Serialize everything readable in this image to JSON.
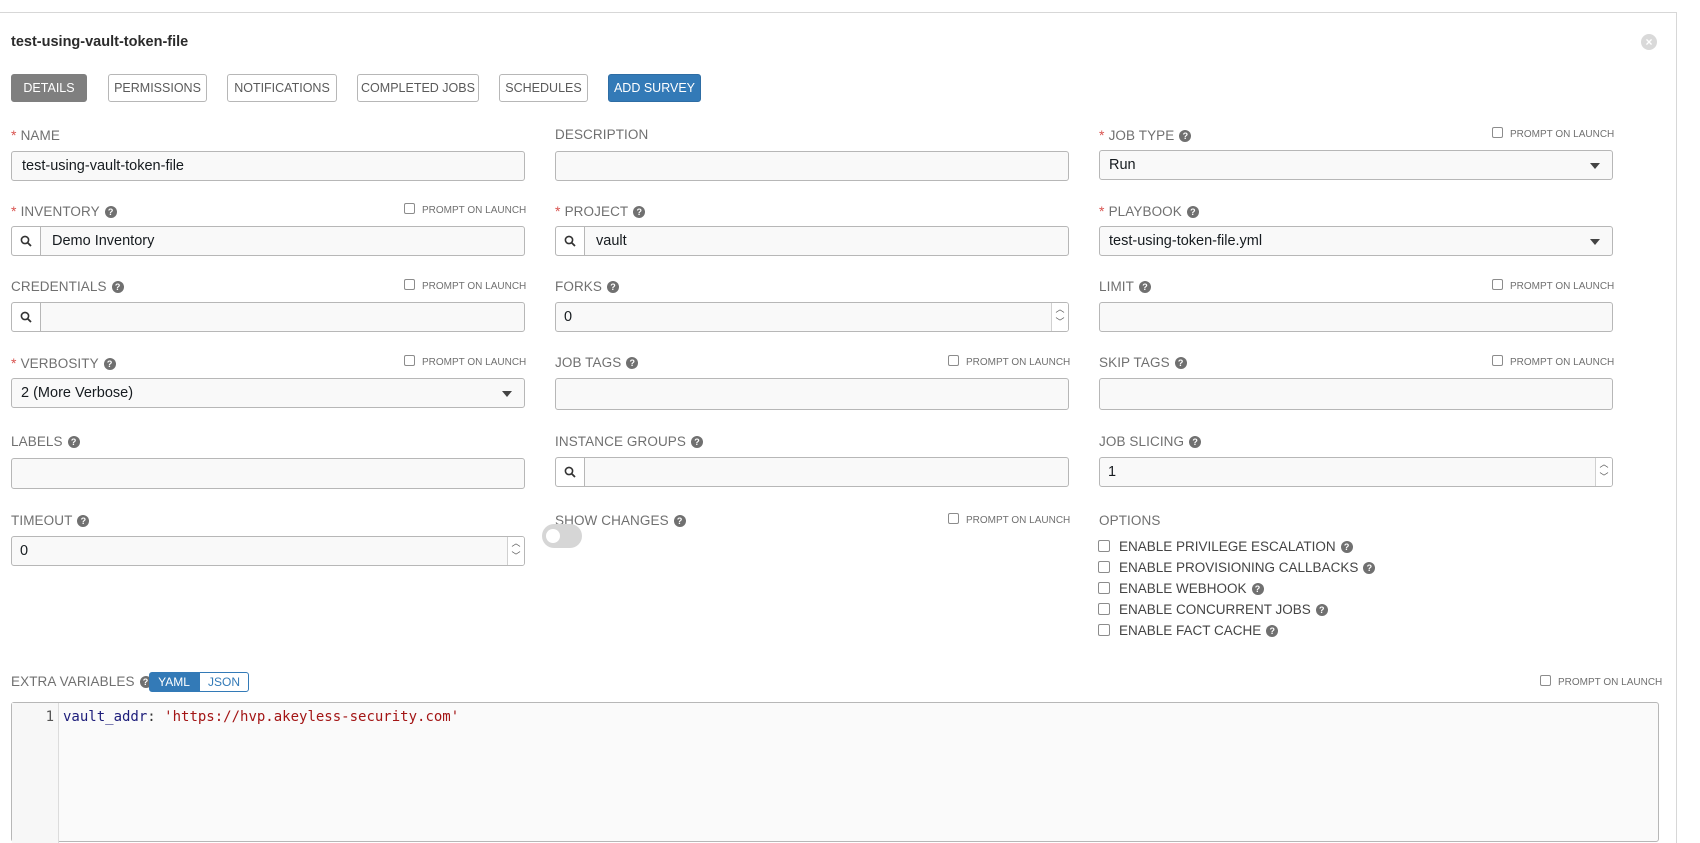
{
  "form": {
    "title": "test-using-vault-token-file",
    "prompt_label": "PROMPT ON LAUNCH"
  },
  "tabs": [
    "DETAILS",
    "PERMISSIONS",
    "NOTIFICATIONS",
    "COMPLETED JOBS",
    "SCHEDULES",
    "ADD SURVEY"
  ],
  "fields": {
    "name": {
      "label": "NAME",
      "value": "test-using-vault-token-file"
    },
    "description": {
      "label": "DESCRIPTION",
      "value": ""
    },
    "job_type": {
      "label": "JOB TYPE",
      "value": "Run"
    },
    "inventory": {
      "label": "INVENTORY",
      "value": "Demo Inventory"
    },
    "project": {
      "label": "PROJECT",
      "value": "vault"
    },
    "playbook": {
      "label": "PLAYBOOK",
      "value": "test-using-token-file.yml"
    },
    "credentials": {
      "label": "CREDENTIALS",
      "value": ""
    },
    "forks": {
      "label": "FORKS",
      "value": "0"
    },
    "limit": {
      "label": "LIMIT",
      "value": ""
    },
    "verbosity": {
      "label": "VERBOSITY",
      "value": "2 (More Verbose)"
    },
    "job_tags": {
      "label": "JOB TAGS",
      "value": ""
    },
    "skip_tags": {
      "label": "SKIP TAGS",
      "value": ""
    },
    "labels": {
      "label": "LABELS",
      "value": ""
    },
    "instance_groups": {
      "label": "INSTANCE GROUPS",
      "value": ""
    },
    "job_slicing": {
      "label": "JOB SLICING",
      "value": "1"
    },
    "timeout": {
      "label": "TIMEOUT",
      "value": "0"
    },
    "show_changes": {
      "label": "SHOW CHANGES",
      "enabled": false
    }
  },
  "options": {
    "label": "OPTIONS",
    "items": [
      "ENABLE PRIVILEGE ESCALATION",
      "ENABLE PROVISIONING CALLBACKS",
      "ENABLE WEBHOOK",
      "ENABLE CONCURRENT JOBS",
      "ENABLE FACT CACHE"
    ]
  },
  "extra_vars": {
    "label": "EXTRA VARIABLES",
    "formats": [
      "YAML",
      "JSON"
    ],
    "line_number": "1",
    "key": "vault_addr",
    "sep": ": ",
    "value": "'https://hvp.akeyless-security.com'"
  },
  "colors": {
    "primary": "#337ab7",
    "required": "#d9534f",
    "active_tab": "#7f7f7f"
  }
}
